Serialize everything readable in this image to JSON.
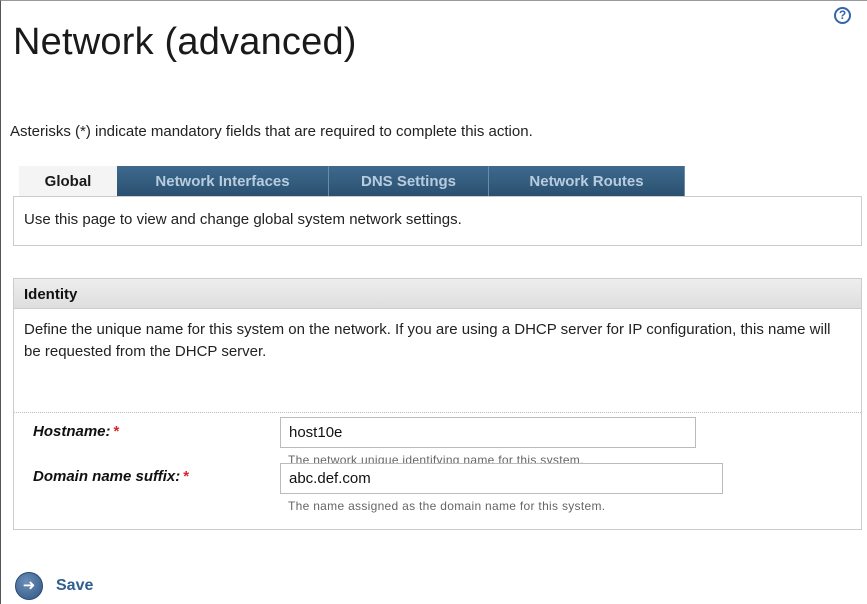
{
  "page": {
    "title": "Network (advanced)",
    "help_icon": "question-circle-icon",
    "mandatory_note": "Asterisks (*) indicate mandatory fields that are required to complete this action."
  },
  "tabs": [
    {
      "label": "Global",
      "active": true
    },
    {
      "label": "Network Interfaces",
      "active": false
    },
    {
      "label": "DNS Settings",
      "active": false
    },
    {
      "label": "Network Routes",
      "active": false
    }
  ],
  "global_panel": {
    "description": "Use this page to view and change global system network settings."
  },
  "identity": {
    "header": "Identity",
    "description": "Define the unique name for this system on the network. If you are using a DHCP server for IP configuration, this name will be requested from the DHCP server.",
    "fields": [
      {
        "label": "Hostname:",
        "required_mark": "*",
        "value": "host10e",
        "hint": "The network unique identifying name for this system."
      },
      {
        "label": "Domain name suffix:",
        "required_mark": "*",
        "value": "abc.def.com",
        "hint": "The name assigned as the domain name for this system."
      }
    ]
  },
  "actions": {
    "save_label": "Save",
    "save_icon": "arrow-right-circle-icon"
  },
  "colors": {
    "tab_bg": "#2a5070",
    "tab_text": "#b8cce0",
    "required": "#d9232d",
    "link": "#2f5f8f"
  }
}
